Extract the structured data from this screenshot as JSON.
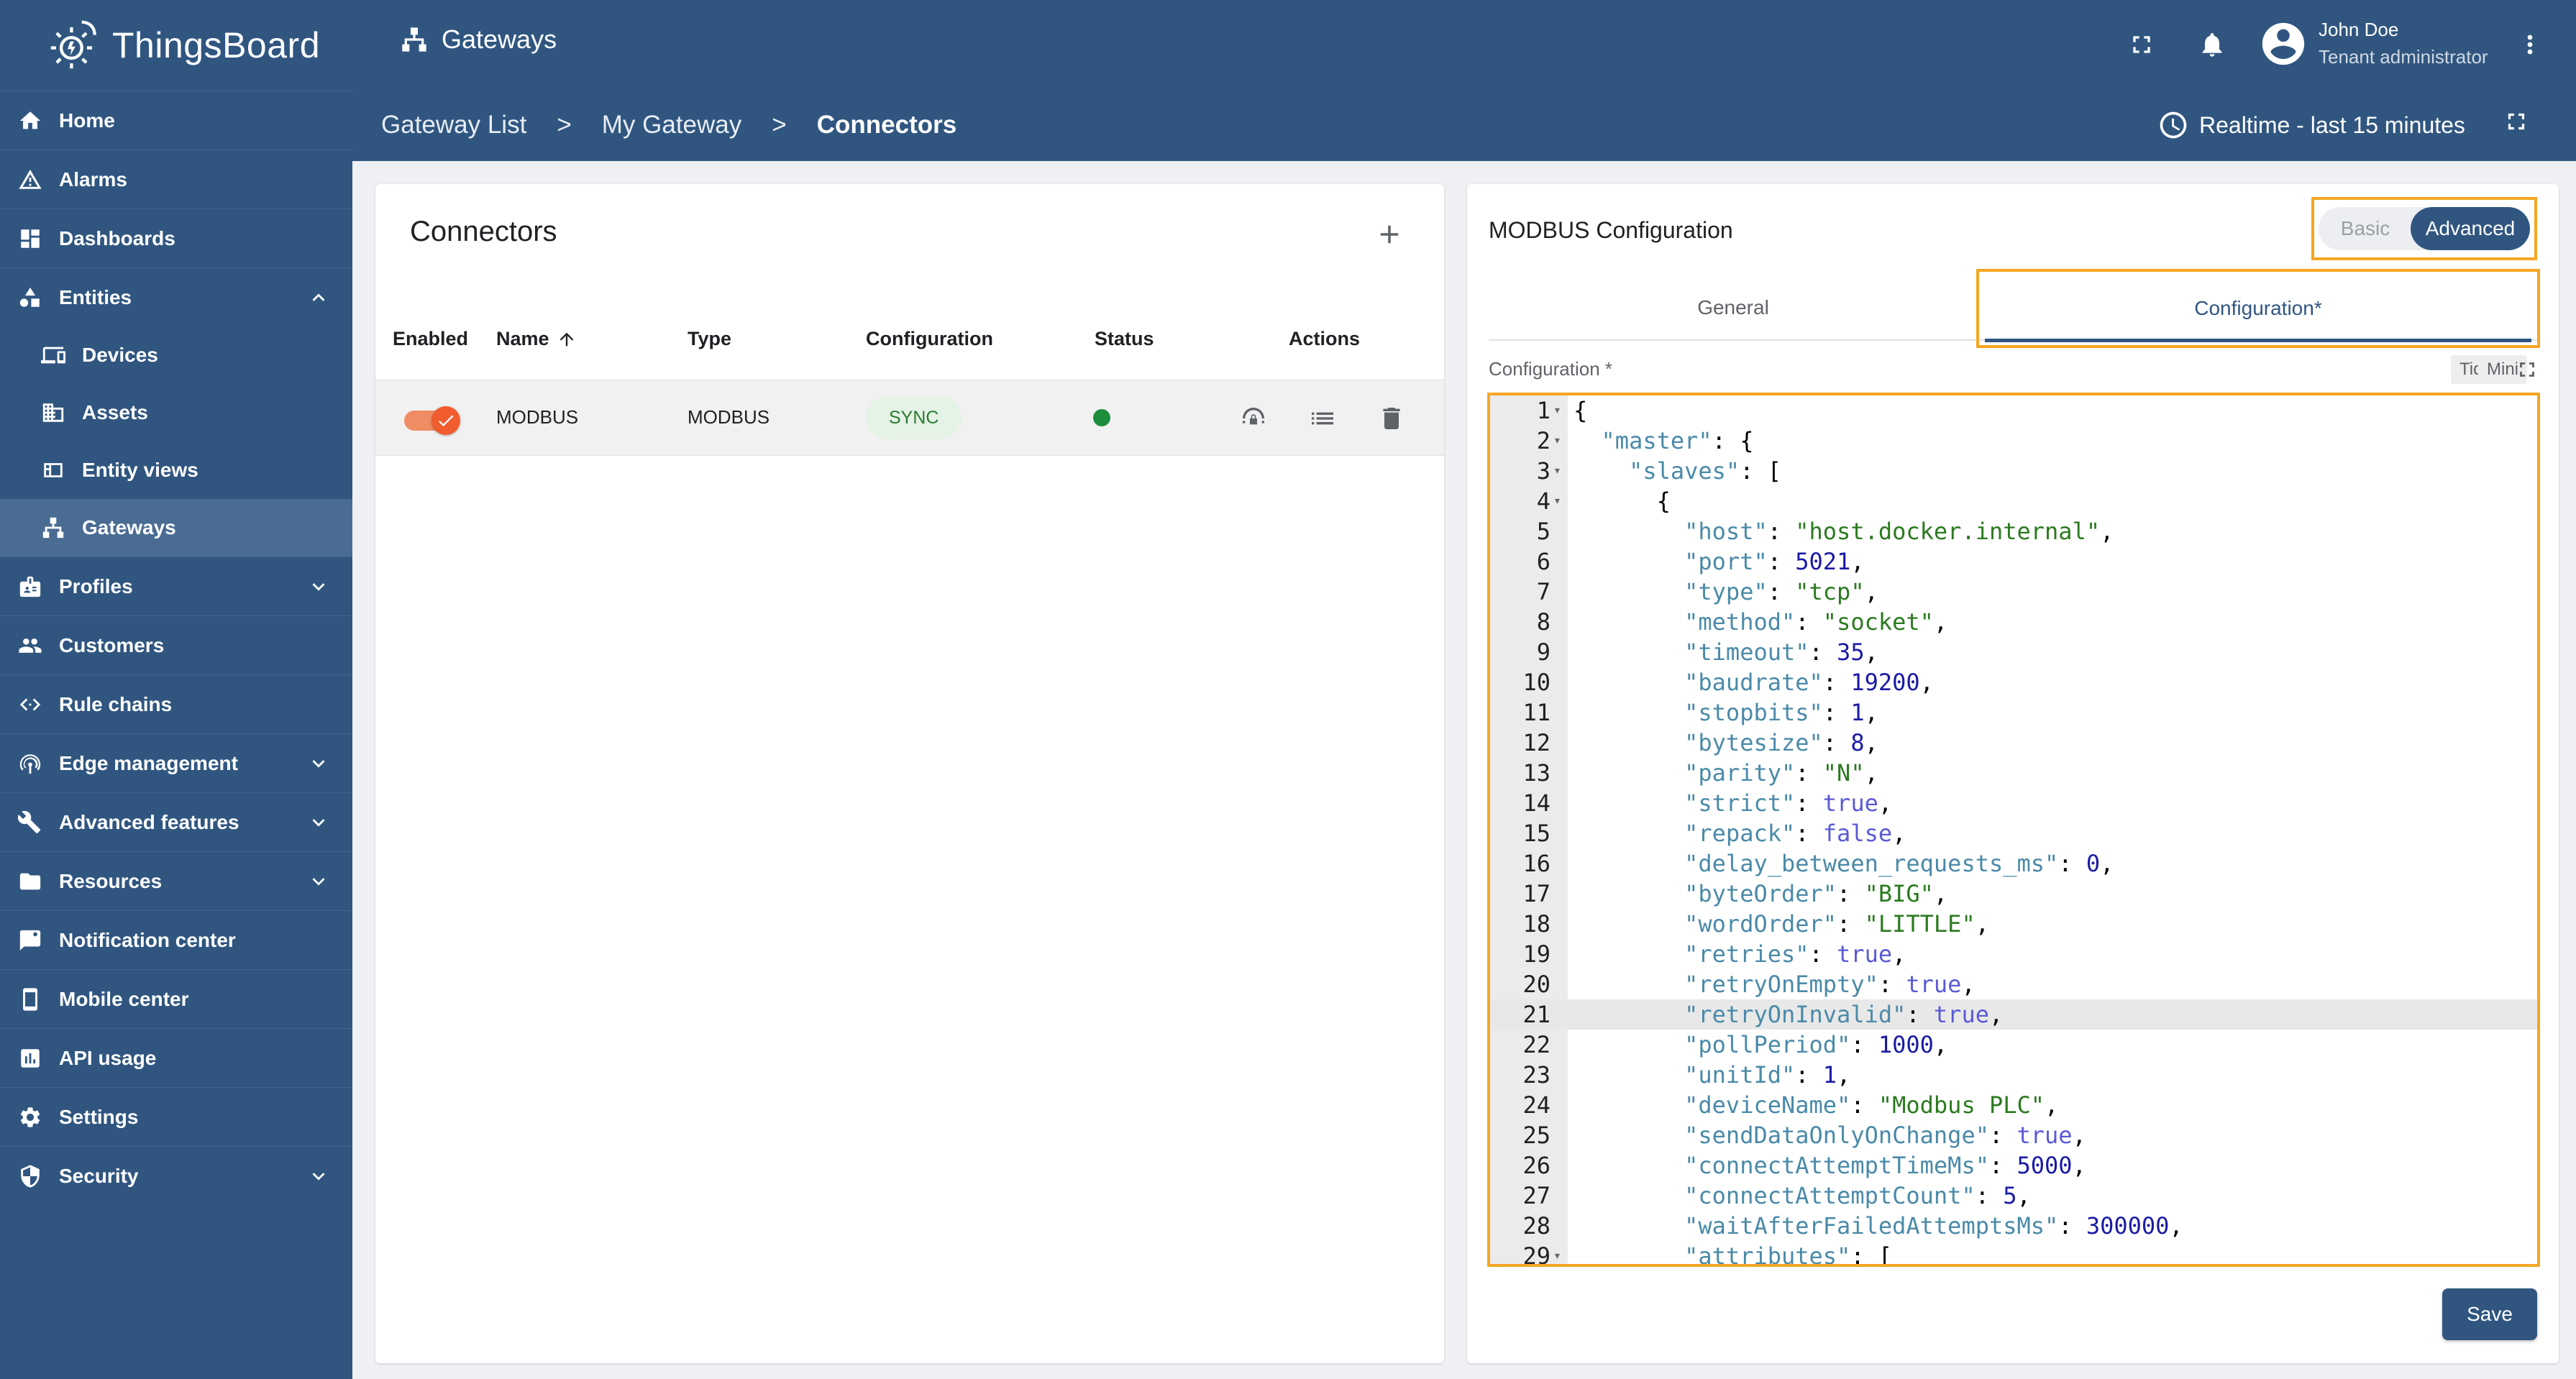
{
  "app": {
    "name": "ThingsBoard"
  },
  "sidebar": {
    "items": [
      {
        "label": "Home",
        "icon": "home-icon"
      },
      {
        "label": "Alarms",
        "icon": "warning-icon"
      },
      {
        "label": "Dashboards",
        "icon": "dashboard-icon"
      },
      {
        "label": "Entities",
        "icon": "entities-icon",
        "expanded": true
      },
      {
        "label": "Devices",
        "icon": "devices-icon",
        "sub": true
      },
      {
        "label": "Assets",
        "icon": "assets-icon",
        "sub": true
      },
      {
        "label": "Entity views",
        "icon": "entity-views-icon",
        "sub": true
      },
      {
        "label": "Gateways",
        "icon": "gateway-icon",
        "sub": true,
        "active": true
      },
      {
        "label": "Profiles",
        "icon": "profiles-icon",
        "collapsible": true
      },
      {
        "label": "Customers",
        "icon": "customers-icon"
      },
      {
        "label": "Rule chains",
        "icon": "rule-chains-icon"
      },
      {
        "label": "Edge management",
        "icon": "edge-icon",
        "collapsible": true
      },
      {
        "label": "Advanced features",
        "icon": "advanced-features-icon",
        "collapsible": true
      },
      {
        "label": "Resources",
        "icon": "folder-icon",
        "collapsible": true
      },
      {
        "label": "Notification center",
        "icon": "notification-center-icon"
      },
      {
        "label": "Mobile center",
        "icon": "mobile-icon"
      },
      {
        "label": "API usage",
        "icon": "api-usage-icon"
      },
      {
        "label": "Settings",
        "icon": "settings-icon"
      },
      {
        "label": "Security",
        "icon": "security-icon",
        "collapsible": true
      }
    ]
  },
  "header": {
    "title": "Gateways",
    "user": {
      "name": "John Doe",
      "role": "Tenant administrator"
    },
    "breadcrumb": {
      "item1": "Gateway List",
      "sep": ">",
      "item2": "My Gateway",
      "current": "Connectors"
    },
    "timewindow": "Realtime - last 15 minutes"
  },
  "connectors": {
    "title": "Connectors",
    "columns": {
      "enabled": "Enabled",
      "name": "Name",
      "type": "Type",
      "configuration": "Configuration",
      "status": "Status",
      "actions": "Actions"
    },
    "rows": [
      {
        "enabled": true,
        "name": "MODBUS",
        "type": "MODBUS",
        "configuration": "SYNC",
        "status": "active"
      }
    ]
  },
  "config_panel": {
    "title": "MODBUS Configuration",
    "mode": {
      "basic": "Basic",
      "advanced": "Advanced",
      "selected": "Advanced"
    },
    "tabs": {
      "general": "General",
      "configuration": "Configuration*"
    },
    "field_label": "Configuration *",
    "editor_buttons": {
      "tidy": "Tidy",
      "mini": "Mini"
    },
    "active_line": 21,
    "code_lines": [
      "{",
      "  \"master\": {",
      "    \"slaves\": [",
      "      {",
      "        \"host\": \"host.docker.internal\",",
      "        \"port\": 5021,",
      "        \"type\": \"tcp\",",
      "        \"method\": \"socket\",",
      "        \"timeout\": 35,",
      "        \"baudrate\": 19200,",
      "        \"stopbits\": 1,",
      "        \"bytesize\": 8,",
      "        \"parity\": \"N\",",
      "        \"strict\": true,",
      "        \"repack\": false,",
      "        \"delay_between_requests_ms\": 0,",
      "        \"byteOrder\": \"BIG\",",
      "        \"wordOrder\": \"LITTLE\",",
      "        \"retries\": true,",
      "        \"retryOnEmpty\": true,",
      "        \"retryOnInvalid\": true,",
      "        \"pollPeriod\": 1000,",
      "        \"unitId\": 1,",
      "        \"deviceName\": \"Modbus PLC\",",
      "        \"sendDataOnlyOnChange\": true,",
      "        \"connectAttemptTimeMs\": 5000,",
      "        \"connectAttemptCount\": 5,",
      "        \"waitAfterFailedAttemptsMs\": 300000,",
      "        \"attributes\": ["
    ],
    "fold_lines": [
      1,
      2,
      3,
      4,
      29
    ],
    "save_label": "Save"
  },
  "colors": {
    "primary": "#305680",
    "accent": "#f15d2f",
    "highlight": "#f5a623",
    "status_ok": "#1e8e3e"
  }
}
